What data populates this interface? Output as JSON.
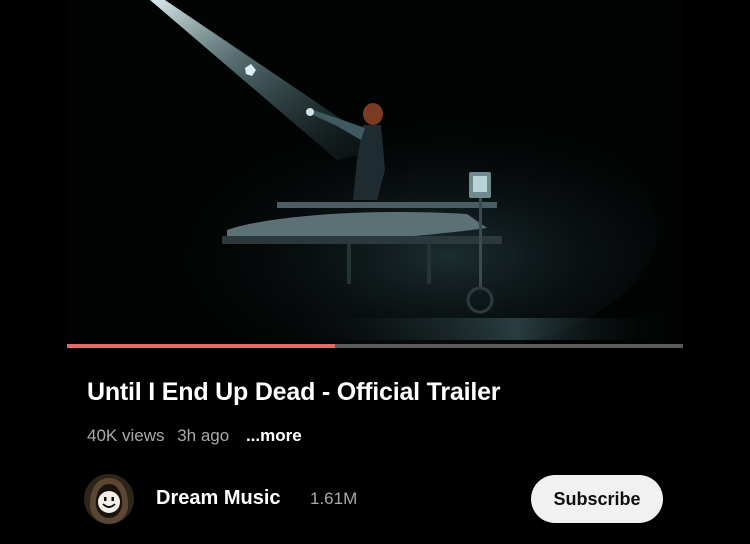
{
  "video": {
    "title": "Until I End Up Dead - Official Trailer",
    "progress_fraction": 0.435
  },
  "meta": {
    "views": "40K views",
    "age": "3h ago",
    "more_label": "...more"
  },
  "channel": {
    "name": "Dream Music",
    "subscribers": "1.61M",
    "avatar_icon": "dream-mask-icon"
  },
  "actions": {
    "subscribe_label": "Subscribe"
  },
  "colors": {
    "background": "#000000",
    "progress_fill": "#e56a67",
    "progress_track": "#5a5a5a",
    "subscribe_bg": "#f1f1f1"
  }
}
